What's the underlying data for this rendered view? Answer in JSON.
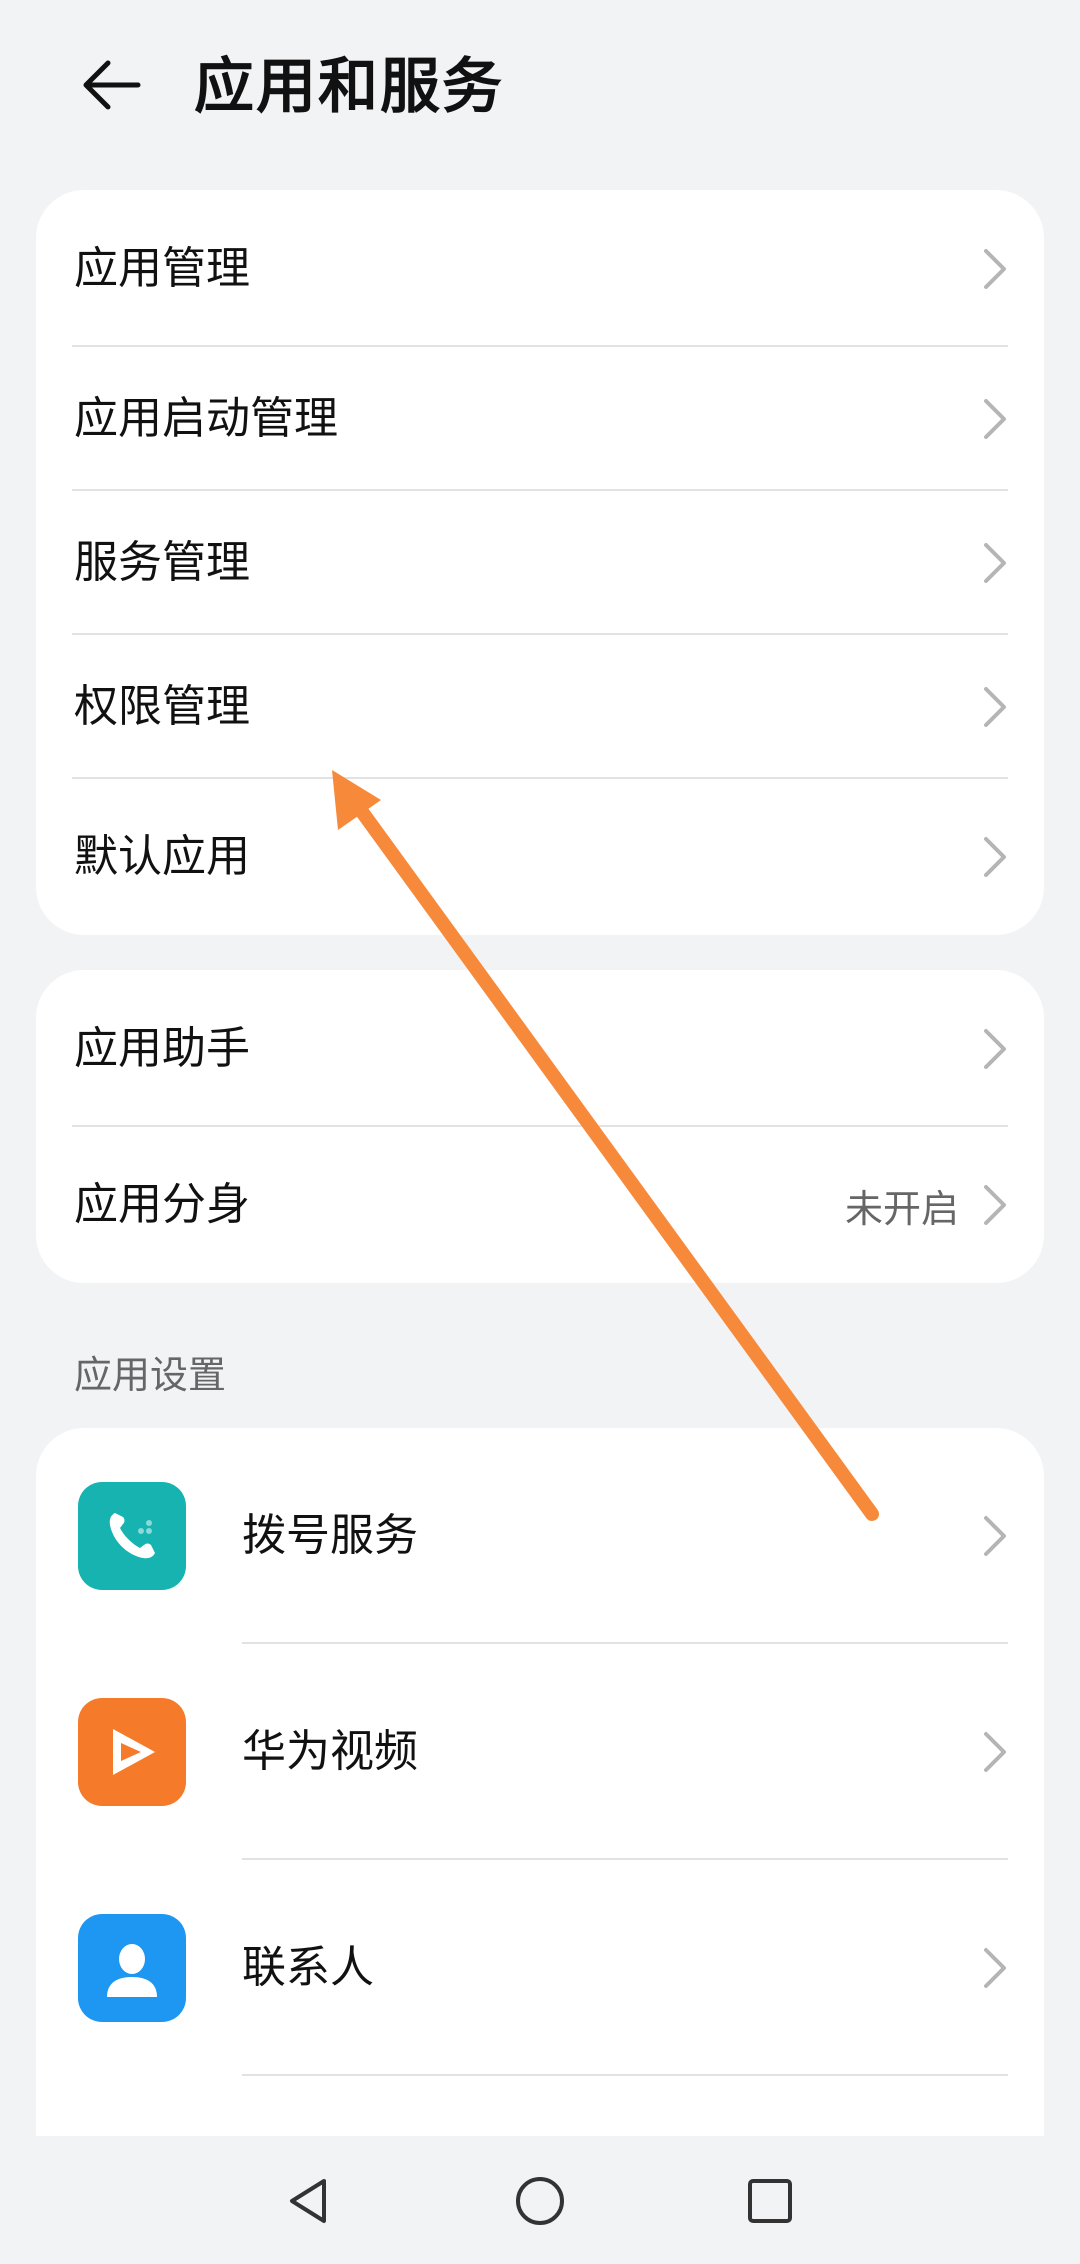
{
  "header": {
    "back_icon": "back-arrow-icon",
    "title": "应用和服务"
  },
  "card1": {
    "items": [
      {
        "label": "应用管理"
      },
      {
        "label": "应用启动管理"
      },
      {
        "label": "服务管理"
      },
      {
        "label": "权限管理"
      },
      {
        "label": "默认应用"
      }
    ]
  },
  "card2": {
    "items": [
      {
        "label": "应用助手"
      },
      {
        "label": "应用分身",
        "value": "未开启"
      }
    ]
  },
  "app_settings": {
    "section_title": "应用设置",
    "apps": [
      {
        "label": "拨号服务",
        "icon": "phone-icon",
        "color": "#16b3b0"
      },
      {
        "label": "华为视频",
        "icon": "video-play-icon",
        "color": "#f57b2a"
      },
      {
        "label": "联系人",
        "icon": "contact-person-icon",
        "color": "#1d97f2"
      }
    ]
  },
  "annotation": {
    "arrow_color": "#f78a3a"
  },
  "navbar": {
    "icons": [
      "nav-back-icon",
      "nav-home-icon",
      "nav-recents-icon"
    ]
  }
}
